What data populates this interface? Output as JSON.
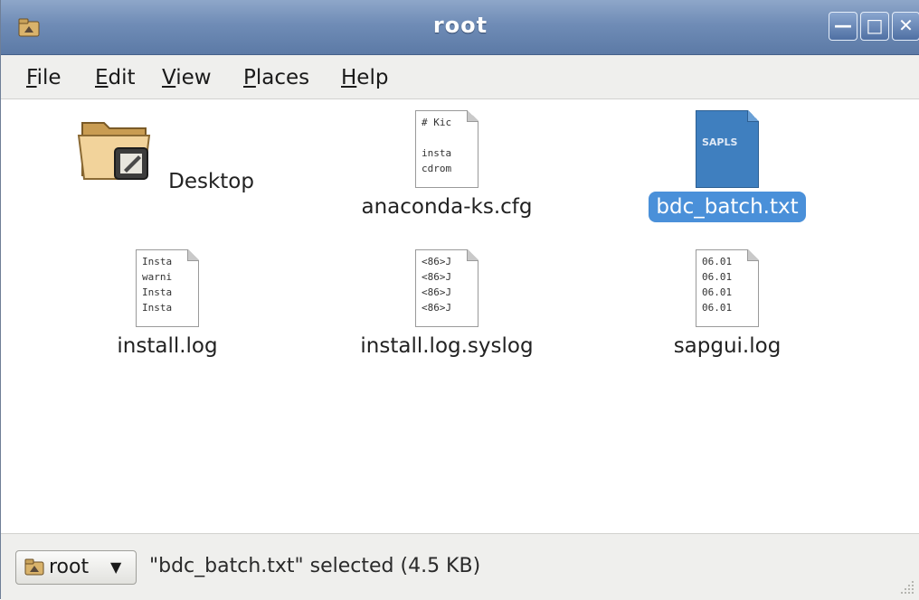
{
  "window": {
    "title": "root"
  },
  "menubar": {
    "items": [
      {
        "mnemonic": "F",
        "rest": "ile"
      },
      {
        "mnemonic": "E",
        "rest": "dit"
      },
      {
        "mnemonic": "V",
        "rest": "iew"
      },
      {
        "mnemonic": "P",
        "rest": "laces"
      },
      {
        "mnemonic": "H",
        "rest": "elp"
      }
    ]
  },
  "files": [
    {
      "name": "Desktop",
      "icon": "folder-icon",
      "preview": []
    },
    {
      "name": "anaconda-ks.cfg",
      "icon": "text-file-icon",
      "preview": [
        "# Kic",
        "",
        "insta",
        "cdrom"
      ]
    },
    {
      "name": "bdc_batch.txt",
      "icon": "document-file-icon",
      "preview": [
        "SAPLS"
      ],
      "selected": true
    },
    {
      "name": "install.log",
      "icon": "text-file-icon",
      "preview": [
        "Insta",
        "warni",
        "Insta",
        "Insta"
      ]
    },
    {
      "name": "install.log.syslog",
      "icon": "text-file-icon",
      "preview": [
        "<86>J",
        "<86>J",
        "<86>J",
        "<86>J"
      ]
    },
    {
      "name": "sapgui.log",
      "icon": "text-file-icon",
      "preview": [
        "06.01",
        "06.01",
        "06.01",
        "06.01"
      ]
    }
  ],
  "statusbar": {
    "location_label": "root",
    "status_text": "\"bdc_batch.txt\" selected (4.5 KB)"
  },
  "colors": {
    "titlebar": "#6f8cb6",
    "selection": "#4a90d9",
    "chrome": "#efefed"
  }
}
